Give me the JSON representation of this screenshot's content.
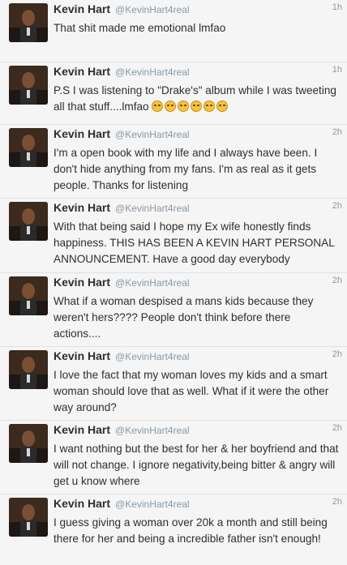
{
  "tweets": [
    {
      "name": "Kevin Hart",
      "handle": "@KevinHart4real",
      "time": "1h",
      "text": "That shit made me emotional lmfao"
    },
    {
      "name": "Kevin Hart",
      "handle": "@KevinHart4real",
      "time": "1h",
      "text": "P.S I was listening to \"Drake's\" album while I was tweeting all that stuff....lmfao",
      "emoji_count": 6,
      "emoji_icon": "face-with-tears-of-joy-icon"
    },
    {
      "name": "Kevin Hart",
      "handle": "@KevinHart4real",
      "time": "2h",
      "text": "I'm a open book with my life and I always have been. I don't hide anything from my fans. I'm as real as it gets people. Thanks for listening"
    },
    {
      "name": "Kevin Hart",
      "handle": "@KevinHart4real",
      "time": "2h",
      "text": "With that being said I hope my Ex wife honestly finds happiness. THIS HAS BEEN A KEVIN HART PERSONAL ANNOUNCEMENT. Have a good day everybody"
    },
    {
      "name": "Kevin Hart",
      "handle": "@KevinHart4real",
      "time": "2h",
      "text": "What if a woman despised a mans kids because they weren't hers???? People don't think before there actions...."
    },
    {
      "name": "Kevin Hart",
      "handle": "@KevinHart4real",
      "time": "2h",
      "text": "I love the fact that my woman loves my kids and a smart woman should love that as well. What if it were the other way around?"
    },
    {
      "name": "Kevin Hart",
      "handle": "@KevinHart4real",
      "time": "2h",
      "text": "I want nothing but the best for her & her boyfriend and that will not change. I ignore negativity,being bitter & angry will get u know where"
    },
    {
      "name": "Kevin Hart",
      "handle": "@KevinHart4real",
      "time": "2h",
      "text": "I guess giving a woman over 20k a month and still being there for her and being a incredible father isn't enough!"
    }
  ],
  "colors": {
    "name": "#292f33",
    "meta": "#8899a6",
    "background": "#f5f5f5",
    "divider": "#e1e1e1"
  }
}
